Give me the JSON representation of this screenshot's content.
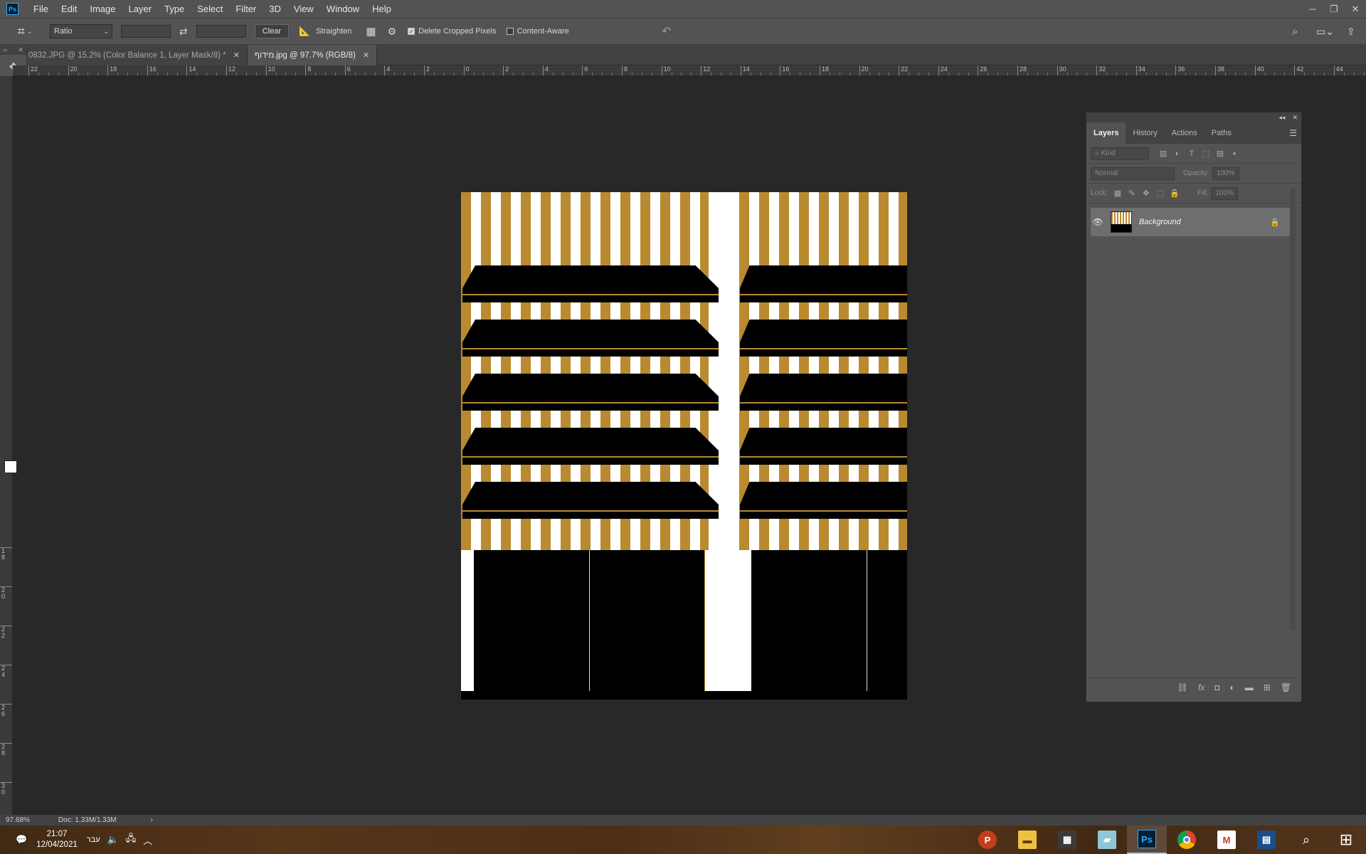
{
  "menubar": {
    "logo": "Ps",
    "items": [
      "File",
      "Edit",
      "Image",
      "Layer",
      "Type",
      "Select",
      "Filter",
      "3D",
      "View",
      "Window",
      "Help"
    ]
  },
  "options": {
    "ratio_value": "Ratio",
    "clear_label": "Clear",
    "straighten_label": "Straighten",
    "delete_cropped_label": "Delete Cropped Pixels",
    "delete_cropped_checked": true,
    "content_aware_label": "Content-Aware",
    "content_aware_checked": false
  },
  "doc_tabs": [
    {
      "label": "0832.JPG @ 15.2% (Color Balance 1, Layer Mask/8) *",
      "active": false
    },
    {
      "label": "מידוף.jpg @ 97.7% (RGB/8)",
      "active": true
    }
  ],
  "ruler_top_labels": [
    "22",
    "20",
    "18",
    "16",
    "14",
    "12",
    "10",
    "8",
    "6",
    "4",
    "2",
    "0",
    "2",
    "4",
    "6",
    "8",
    "10",
    "12",
    "14",
    "16",
    "18",
    "20",
    "22",
    "24",
    "26",
    "28",
    "30",
    "32",
    "34",
    "36",
    "38",
    "40",
    "42",
    "44"
  ],
  "ruler_left_labels": [
    "1 8",
    "2 0",
    "2 2",
    "2 4",
    "2 6",
    "2 8",
    "3 0"
  ],
  "layers_panel": {
    "tabs": [
      "Layers",
      "History",
      "Actions",
      "Paths"
    ],
    "kind_placeholder": "Kind",
    "blend_mode": "Normal",
    "opacity_label": "Opacity:",
    "opacity_value": "100%",
    "lock_label": "Lock:",
    "fill_label": "Fill:",
    "fill_value": "100%",
    "layers": [
      {
        "name": "Background",
        "visible": true,
        "locked": true
      }
    ]
  },
  "status": {
    "zoom": "97.68%",
    "doc_size": "Doc: 1.33M/1.33M"
  },
  "taskbar": {
    "time": "21:07",
    "date": "12/04/2021",
    "language": "עבר",
    "apps": [
      "powerpoint",
      "file-explorer",
      "calculator",
      "notes",
      "photoshop",
      "chrome",
      "gmail",
      "remote-desktop"
    ],
    "active_app": "photoshop"
  },
  "colors": {
    "foreground": "#ffffff",
    "background": "#b88a2e",
    "stripe_gold": "#ba8a30"
  }
}
